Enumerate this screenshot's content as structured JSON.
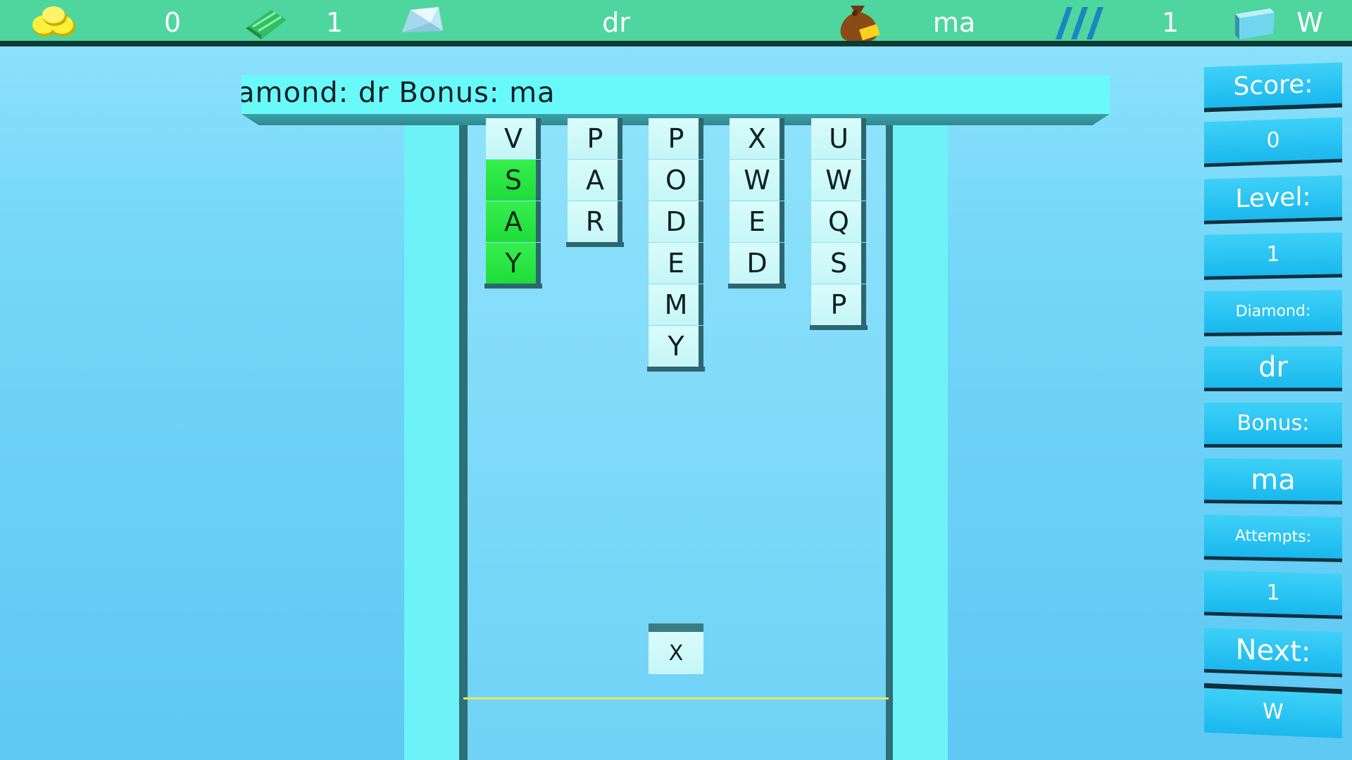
{
  "hud": {
    "coins_icon": "coins-icon",
    "coins": "0",
    "gem_icon": "green-gem-icon",
    "gems": "1",
    "diamond_icon": "diamond-icon",
    "diamond": "dr",
    "bonus_icon": "money-bag-icon",
    "bonus": "ma",
    "attempts_icon": "attempts-stripes-icon",
    "attempts": "1",
    "next_icon": "next-block-icon",
    "next": "W"
  },
  "ticker": {
    "text": "amond:  dr  Bonus:  ma"
  },
  "board": {
    "columns": [
      {
        "letters": [
          "V",
          "S",
          "A",
          "Y"
        ],
        "green": [
          false,
          true,
          true,
          true
        ]
      },
      {
        "letters": [
          "P",
          "A",
          "R"
        ],
        "green": [
          false,
          false,
          false
        ]
      },
      {
        "letters": [
          "P",
          "O",
          "D",
          "E",
          "M",
          "Y"
        ],
        "green": [
          false,
          false,
          false,
          false,
          false,
          false
        ]
      },
      {
        "letters": [
          "X",
          "W",
          "E",
          "D"
        ],
        "green": [
          false,
          false,
          false,
          false
        ]
      },
      {
        "letters": [
          "U",
          "W",
          "Q",
          "S",
          "P"
        ],
        "green": [
          false,
          false,
          false,
          false,
          false
        ]
      }
    ],
    "falling_letter": "X"
  },
  "panel": {
    "score_label": "Score:",
    "score": "0",
    "level_label": "Level:",
    "level": "1",
    "diamond_label": "Diamond:",
    "diamond": "dr",
    "bonus_label": "Bonus:",
    "bonus": "ma",
    "attempts_label": "Attempts:",
    "attempts": "1",
    "next_label": "Next:",
    "next": "W"
  },
  "colors": {
    "hud": "#4fd59e",
    "tile": "#c5f6f6",
    "tile_matched": "#1fdc3b",
    "panel": "#1ab8ee"
  }
}
